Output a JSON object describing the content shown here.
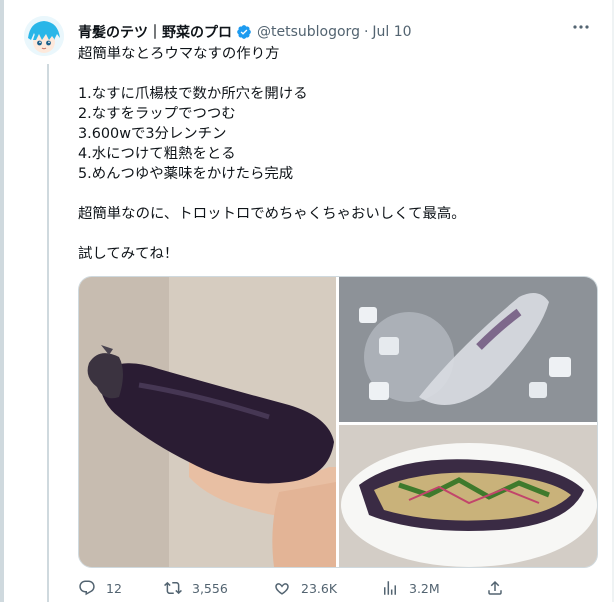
{
  "author": {
    "display_name": "青髪のテツ｜野菜のプロ",
    "handle": "@tetsublogorg",
    "separator": "·",
    "date": "Jul 10"
  },
  "tweet": {
    "lines": [
      "超簡単なとろウマなすの作り方",
      "",
      "1.なすに爪楊枝で数か所穴を開ける",
      "2.なすをラップでつつむ",
      "3.600wで3分レンチン",
      "4.水につけて粗熱をとる",
      "5.めんつゆや薬味をかけたら完成",
      "",
      "超簡単なのに、トロットロでめちゃくちゃおいしくて最高。",
      "",
      "試してみてね！"
    ]
  },
  "actions": {
    "replies": "12",
    "retweets": "3,556",
    "likes": "23.6K",
    "views": "3.2M"
  },
  "colors": {
    "verified": "#1d9bf0",
    "text_secondary": "#536471",
    "border": "#cfd9de"
  },
  "icons": [
    "verified-icon",
    "more-icon",
    "reply-icon",
    "retweet-icon",
    "like-icon",
    "views-icon",
    "share-icon"
  ]
}
